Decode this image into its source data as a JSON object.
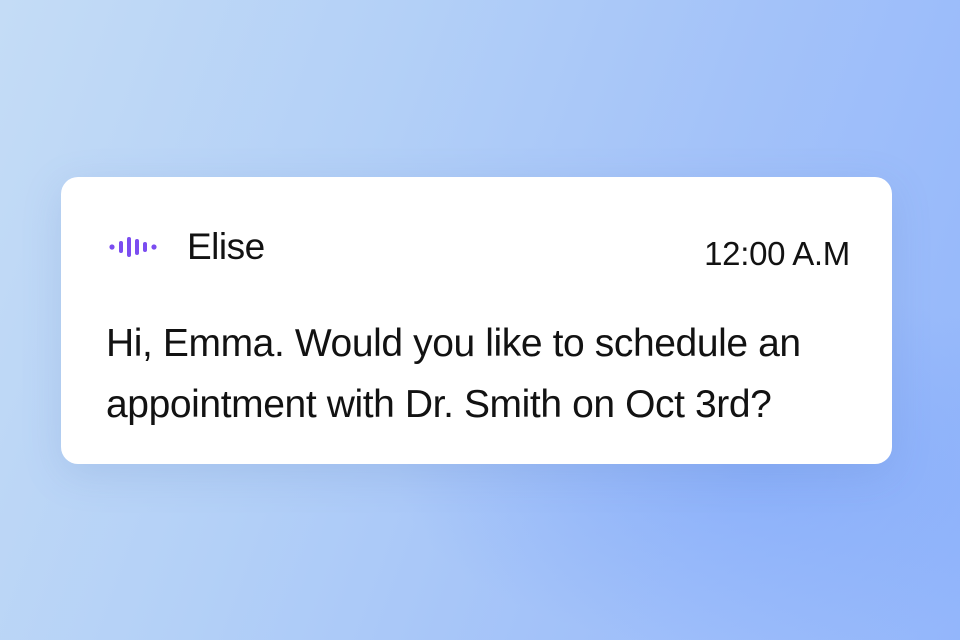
{
  "notification": {
    "sender": "Elise",
    "time": "12:00 A.M",
    "message": "Hi, Emma. Would you like to schedule an appointment with Dr. Smith on Oct 3rd?",
    "icon": "sound-wave-icon",
    "accent_color": "#7b4df0"
  }
}
